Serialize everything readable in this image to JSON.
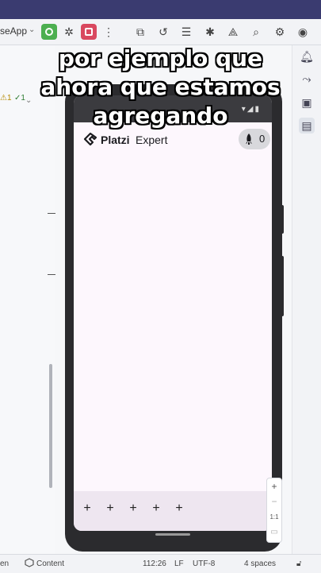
{
  "toolbar": {
    "app_name": "seApp",
    "icons": [
      "run-icon",
      "debug-icon",
      "stop-icon",
      "more-icon",
      "profile-icon",
      "apply-changes-icon",
      "list-icon",
      "bug-icon",
      "device-icon",
      "search-icon",
      "gear-icon",
      "account-icon"
    ]
  },
  "gutter": {
    "warning_count": "1",
    "check_count": "1"
  },
  "caption": {
    "line1": "por ejemplo que",
    "line2": "ahora que estamos",
    "line3": "agregando"
  },
  "app": {
    "brand_name": "Platzi",
    "brand_suffix": "Expert",
    "points": "0",
    "nav_items": [
      "+",
      "+",
      "+",
      "+",
      "+"
    ]
  },
  "zoom": {
    "plus": "+",
    "minus": "−",
    "ratio": "1:1"
  },
  "status_bar": {
    "left_text": "en",
    "content_label": "Content",
    "position": "112:26",
    "line_ending": "LF",
    "encoding": "UTF-8",
    "indent": "4 spaces"
  },
  "colors": {
    "run_green": "#4caf50",
    "stop_red": "#d9485f",
    "screen_bg": "#fdf7fd",
    "nav_bg": "#eee6f0"
  }
}
